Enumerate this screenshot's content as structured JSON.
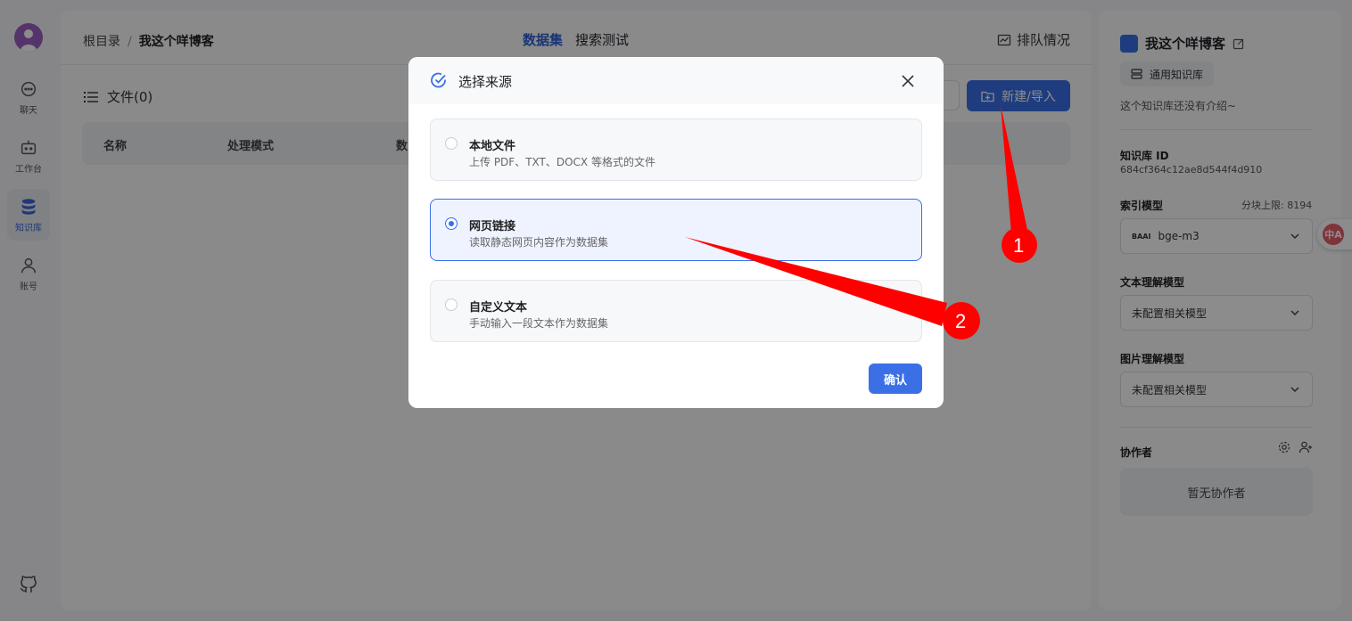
{
  "nav": {
    "items": [
      {
        "label": "聊天",
        "icon": "chat-icon"
      },
      {
        "label": "工作台",
        "icon": "robot-icon"
      },
      {
        "label": "知识库",
        "icon": "database-icon"
      },
      {
        "label": "账号",
        "icon": "user-icon"
      }
    ]
  },
  "header": {
    "breadcrumb_root": "根目录",
    "breadcrumb_sep": "/",
    "breadcrumb_current": "我这个咩博客",
    "tab_dataset": "数据集",
    "tab_search": "搜索测试",
    "queue_label": "排队情况"
  },
  "content": {
    "files_title": "文件(0)",
    "new_button": "新建/导入",
    "columns": [
      "名称",
      "处理模式",
      "数"
    ]
  },
  "side": {
    "kb_name": "我这个咩博客",
    "kb_tag": "通用知识库",
    "intro": "这个知识库还没有介绍~",
    "id_label": "知识库 ID",
    "id_value": "684cf364c12ae8d544f4d910",
    "index_label": "索引模型",
    "chunk_limit": "分块上限: 8194",
    "index_model": "bge-m3",
    "index_model_brand": "BAAI",
    "text_label": "文本理解模型",
    "text_model": "未配置相关模型",
    "image_label": "图片理解模型",
    "image_model": "未配置相关模型",
    "collab_label": "协作者",
    "collab_empty": "暂无协作者"
  },
  "translate_badge": "中A",
  "modal": {
    "title": "选择来源",
    "options": [
      {
        "title": "本地文件",
        "desc": "上传 PDF、TXT、DOCX 等格式的文件",
        "selected": false
      },
      {
        "title": "网页链接",
        "desc": "读取静态网页内容作为数据集",
        "selected": true
      },
      {
        "title": "自定义文本",
        "desc": "手动输入一段文本作为数据集",
        "selected": false
      }
    ],
    "confirm": "确认"
  },
  "annotations": {
    "marker1": "1",
    "marker2": "2",
    "color": "#ff0000"
  }
}
